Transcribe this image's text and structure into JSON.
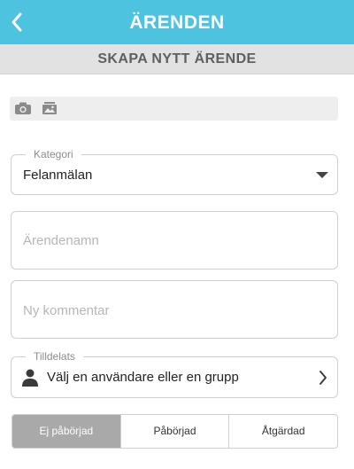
{
  "header": {
    "title": "ÄRENDEN",
    "back_icon": "chevron-left-icon"
  },
  "subheader": {
    "title": "SKAPA NYTT ÄRENDE"
  },
  "media": {
    "camera_icon": "camera-icon",
    "gallery_icon": "image-gallery-icon"
  },
  "category": {
    "label": "Kategori",
    "value": "Felanmälan"
  },
  "case_name": {
    "placeholder": "Ärendenamn"
  },
  "comment": {
    "placeholder": "Ny kommentar"
  },
  "assignee": {
    "label": "Tilldelats",
    "value": "Välj en användare eller en grupp"
  },
  "status": {
    "options": [
      "Ej påbörjad",
      "Påbörjad",
      "Åtgärdad"
    ],
    "selected": "Ej påbörjad"
  },
  "colors": {
    "header": "#4dc3e0",
    "subheader": "#e2e2e2",
    "selected_segment": "#a9a9a9"
  }
}
